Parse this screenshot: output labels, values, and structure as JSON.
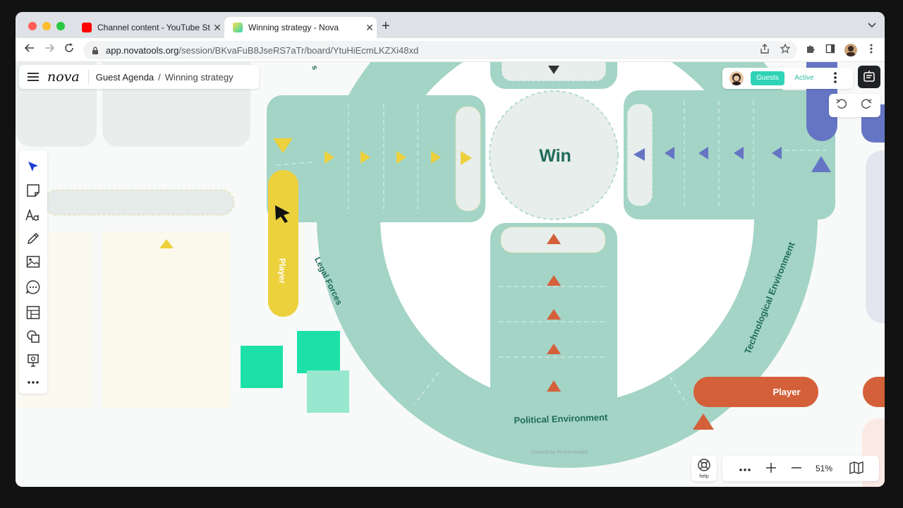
{
  "browser": {
    "tabs": [
      {
        "title": "Channel content - YouTube Stu",
        "close": "✕"
      },
      {
        "title": "Winning strategy - Nova",
        "close": "✕"
      }
    ],
    "new_tab": "+",
    "url_host": "app.novatools.org",
    "url_path": "/session/BKvaFuB8JseRS7aTr/board/YtuHiEcmLKZXi48xd"
  },
  "app": {
    "logo": "nova",
    "breadcrumb_parent": "Guest Agenda",
    "breadcrumb_sep": "/",
    "breadcrumb_current": "Winning strategy",
    "guests_label": "Guests",
    "active_label": "Active",
    "help_label": "help",
    "zoom_level": "51%"
  },
  "board": {
    "center_label": "Win",
    "player_yellow": "Player",
    "player_orange": "Player",
    "ring_labels": {
      "legal": "Legal Forces",
      "political": "Political Environment",
      "technological": "Technological Environment",
      "top_partial": "s"
    },
    "credit": "Created by Ro Fernandez",
    "colors": {
      "ring": "#a3d4c6",
      "yellow": "#ecd13d",
      "orange": "#d4603a",
      "blue": "#6575c4",
      "mint": "#1de0a8",
      "center": "#e7eeec"
    }
  }
}
